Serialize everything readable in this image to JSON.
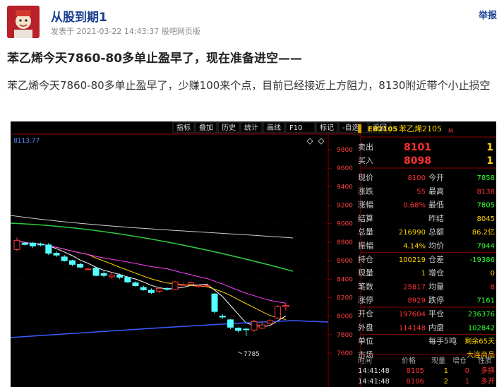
{
  "post": {
    "username": "从股到期1",
    "meta": "发表于 2021-03-22 14:43:37 股吧网页版",
    "report": "举报",
    "title": "苯乙烯今天7860-80多单止盈早了，现在准备进空——",
    "body": "苯乙烯今天7860-80多单止盈早了，少赚100来个点，目前已经接近上方阻力，8130附近带个小止损空"
  },
  "toolbar": {
    "items": [
      "指标",
      "叠加",
      "历史",
      "统计",
      "画线",
      "F10",
      "标记",
      "-自选",
      "返回"
    ]
  },
  "chart_header": {
    "label": "8113.77"
  },
  "axis": {
    "ticks": [
      "9800",
      "9600",
      "9400",
      "9200",
      "9000",
      "8800",
      "8600",
      "8400",
      "8200",
      "8000",
      "7800",
      "7600"
    ]
  },
  "low_annotation": "7785",
  "candles": [
    {
      "o": 8720,
      "c": 8820,
      "h": 8850,
      "l": 8700
    },
    {
      "o": 8790,
      "c": 8775,
      "h": 8805,
      "l": 8765
    },
    {
      "o": 8790,
      "c": 8760,
      "h": 8800,
      "l": 8740
    },
    {
      "o": 8780,
      "c": 8770,
      "h": 8795,
      "l": 8755
    },
    {
      "o": 8770,
      "c": 8680,
      "h": 8790,
      "l": 8660
    },
    {
      "o": 8680,
      "c": 8660,
      "h": 8700,
      "l": 8640
    },
    {
      "o": 8640,
      "c": 8600,
      "h": 8660,
      "l": 8590
    },
    {
      "o": 8600,
      "c": 8560,
      "h": 8610,
      "l": 8540
    },
    {
      "o": 8560,
      "c": 8530,
      "h": 8580,
      "l": 8515
    },
    {
      "o": 8510,
      "c": 8510,
      "h": 8520,
      "l": 8500
    },
    {
      "o": 8520,
      "c": 8440,
      "h": 8530,
      "l": 8430
    },
    {
      "o": 8460,
      "c": 8440,
      "h": 8490,
      "l": 8420
    },
    {
      "o": 8425,
      "c": 8445,
      "h": 8465,
      "l": 8405
    },
    {
      "o": 8445,
      "c": 8420,
      "h": 8460,
      "l": 8400
    },
    {
      "o": 8420,
      "c": 8370,
      "h": 8430,
      "l": 8360
    },
    {
      "o": 8360,
      "c": 8330,
      "h": 8375,
      "l": 8320
    },
    {
      "o": 8310,
      "c": 8285,
      "h": 8330,
      "l": 8275
    },
    {
      "o": 8280,
      "c": 8255,
      "h": 8300,
      "l": 8240
    },
    {
      "o": 8270,
      "c": 8300,
      "h": 8310,
      "l": 8250
    },
    {
      "o": 8300,
      "c": 8290,
      "h": 8310,
      "l": 8275
    },
    {
      "o": 8290,
      "c": 8370,
      "h": 8380,
      "l": 8285
    },
    {
      "o": 8340,
      "c": 8340,
      "h": 8360,
      "l": 8330
    },
    {
      "o": 8345,
      "c": 8360,
      "h": 8370,
      "l": 8335
    },
    {
      "o": 8320,
      "c": 8330,
      "h": 8340,
      "l": 8310
    },
    {
      "o": 8330,
      "c": 8330,
      "h": 8340,
      "l": 8320
    },
    {
      "o": 8240,
      "c": 8050,
      "h": 8250,
      "l": 8030
    },
    {
      "o": 8000,
      "c": 7990,
      "h": 8020,
      "l": 7970
    },
    {
      "o": 7960,
      "c": 7880,
      "h": 7970,
      "l": 7860
    },
    {
      "o": 7870,
      "c": 7845,
      "h": 7880,
      "l": 7825
    },
    {
      "o": 7860,
      "c": 7855,
      "h": 7870,
      "l": 7785
    },
    {
      "o": 7850,
      "c": 7940,
      "h": 7960,
      "l": 7830
    },
    {
      "o": 7870,
      "c": 7905,
      "h": 7940,
      "l": 7860
    },
    {
      "o": 7920,
      "c": 7950,
      "h": 7970,
      "l": 7910
    },
    {
      "o": 7980,
      "c": 8100,
      "h": 8120,
      "l": 7970
    },
    {
      "o": 8100,
      "c": 8115,
      "h": 8140,
      "l": 8060
    }
  ],
  "quote": {
    "code": "EB2105",
    "name": "苯乙烯2105",
    "tag": "M",
    "sell_label": "卖出",
    "sell_price": "8101",
    "sell_qty": "1",
    "buy_label": "买入",
    "buy_price": "8098",
    "buy_qty": "1",
    "rows": [
      [
        "现价",
        "8100",
        "今开",
        "7858"
      ],
      [
        "涨跌",
        "55",
        "最高",
        "8138"
      ],
      [
        "涨幅",
        "0.68%",
        "最低",
        "7805"
      ],
      [
        "结算",
        "",
        "昨结",
        "8045"
      ],
      [
        "总量",
        "216990",
        "总额",
        "86.2亿"
      ],
      [
        "振幅",
        "4.14%",
        "均价",
        "7944"
      ],
      [
        "持仓",
        "100219",
        "仓差",
        "-19386"
      ],
      [
        "现量",
        "1",
        "增仓",
        "0"
      ],
      [
        "笔数",
        "25817",
        "均量",
        "8"
      ],
      [
        "涨停",
        "8929",
        "跌停",
        "7161"
      ],
      [
        "开仓",
        "197604",
        "平仓",
        "236376"
      ],
      [
        "外盘",
        "114148",
        "内盘",
        "102842"
      ],
      [
        "单位",
        "",
        "每手5吨",
        "剩余65天"
      ],
      [
        "市场",
        "",
        "",
        "大连商品"
      ]
    ],
    "trades_header": [
      "时间",
      "价格",
      "现量",
      "增仓",
      "性质"
    ],
    "trades": [
      [
        "14:41:48",
        "8105",
        "1",
        "0",
        "多换"
      ],
      [
        "14:41:48",
        "8106",
        "2",
        "1",
        "多开"
      ]
    ]
  }
}
